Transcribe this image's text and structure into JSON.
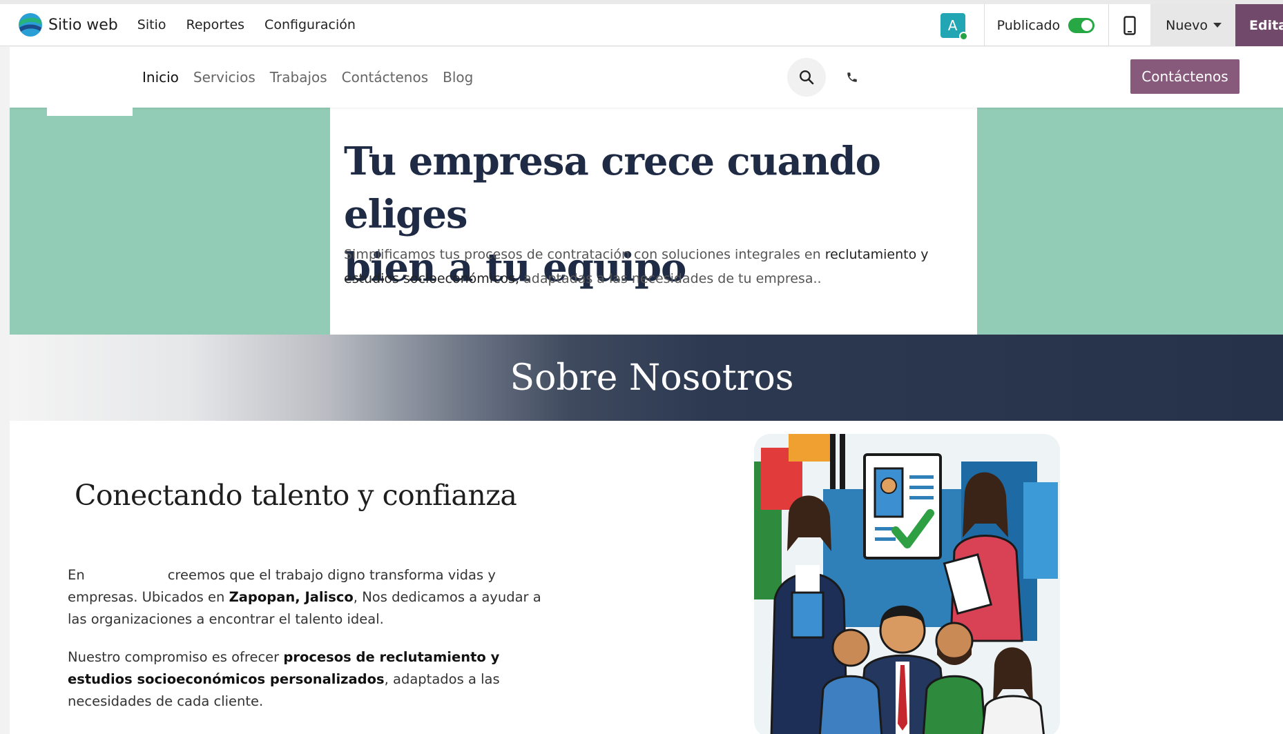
{
  "admin_bar": {
    "brand": "Sitio web",
    "menu": [
      "Sitio",
      "Reportes",
      "Configuración"
    ],
    "avatar_letter": "A",
    "published_label": "Publicado",
    "published": true,
    "new_label": "Nuevo",
    "edit_label": "Editar"
  },
  "site_nav": {
    "links": [
      "Inicio",
      "Servicios",
      "Trabajos",
      "Contáctenos",
      "Blog"
    ],
    "active": "Inicio",
    "cta_label": "Contáctenos"
  },
  "hero": {
    "title_line1": "Tu empresa crece cuando eliges",
    "title_line2": "bien a tu equipo",
    "text_1": "Simplificamos tus procesos de contratación con soluciones integrales en ",
    "text_bold_1": "reclutamiento y estudios socioeconómicos,",
    "text_2": " adaptadas a las necesidades de tu empresa.."
  },
  "about_band": {
    "title": "Sobre Nosotros"
  },
  "about": {
    "title": "Conectando talento y confianza",
    "p1_a": "En",
    "p1_b": "creemos que el trabajo digno transforma vidas y empresas. Ubicados en ",
    "p1_bold": "Zapopan, Jalisco",
    "p1_c": ", Nos dedicamos a ayudar a las organizaciones a encontrar el talento ideal.",
    "p2_a": "Nuestro compromiso es ofrecer ",
    "p2_bold": "procesos de reclutamiento y estudios socioeconómicos personalizados",
    "p2_b": ", adaptados a las necesidades de cada cliente."
  },
  "colors": {
    "brand_purple": "#875a7b",
    "hero_green": "#92cbb6",
    "navy": "#1f2b44",
    "toggle_green": "#28a745"
  },
  "icons": [
    "odoo-website-logo",
    "mobile-preview-icon",
    "search-icon",
    "phone-icon",
    "caret-down-icon"
  ]
}
